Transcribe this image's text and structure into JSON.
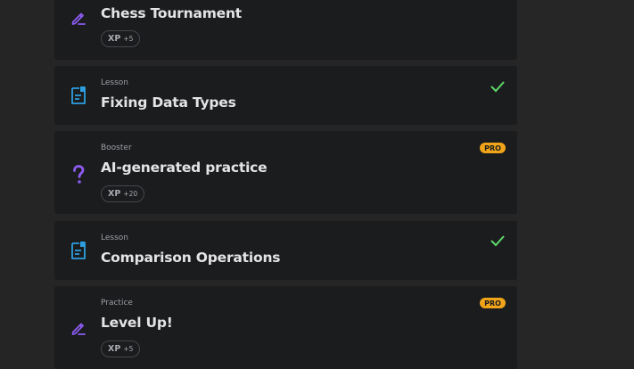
{
  "colors": {
    "background": "#252525",
    "card": "#1b1c1e",
    "practice_icon": "#8c5cf0",
    "lesson_icon": "#2d9fe0",
    "booster_icon": "#8c5cf0",
    "check": "#5ed86a",
    "pro_badge": "#f0a419"
  },
  "items": [
    {
      "kind": "practice",
      "icon": "pencil-icon",
      "type_label": "",
      "title": "Chess Tournament",
      "xp_label": "XP",
      "xp_value": "+5"
    },
    {
      "kind": "lesson",
      "icon": "document-icon",
      "type_label": "Lesson",
      "title": "Fixing Data Types",
      "completed": true
    },
    {
      "kind": "booster",
      "icon": "question-mark-icon",
      "type_label": "Booster",
      "title": "AI-generated practice",
      "badge": "PRO",
      "xp_label": "XP",
      "xp_value": "+20"
    },
    {
      "kind": "lesson",
      "icon": "document-icon",
      "type_label": "Lesson",
      "title": "Comparison Operations",
      "completed": true
    },
    {
      "kind": "practice",
      "icon": "pencil-icon",
      "type_label": "Practice",
      "title": "Level Up!",
      "badge": "PRO",
      "xp_label": "XP",
      "xp_value": "+5"
    }
  ]
}
